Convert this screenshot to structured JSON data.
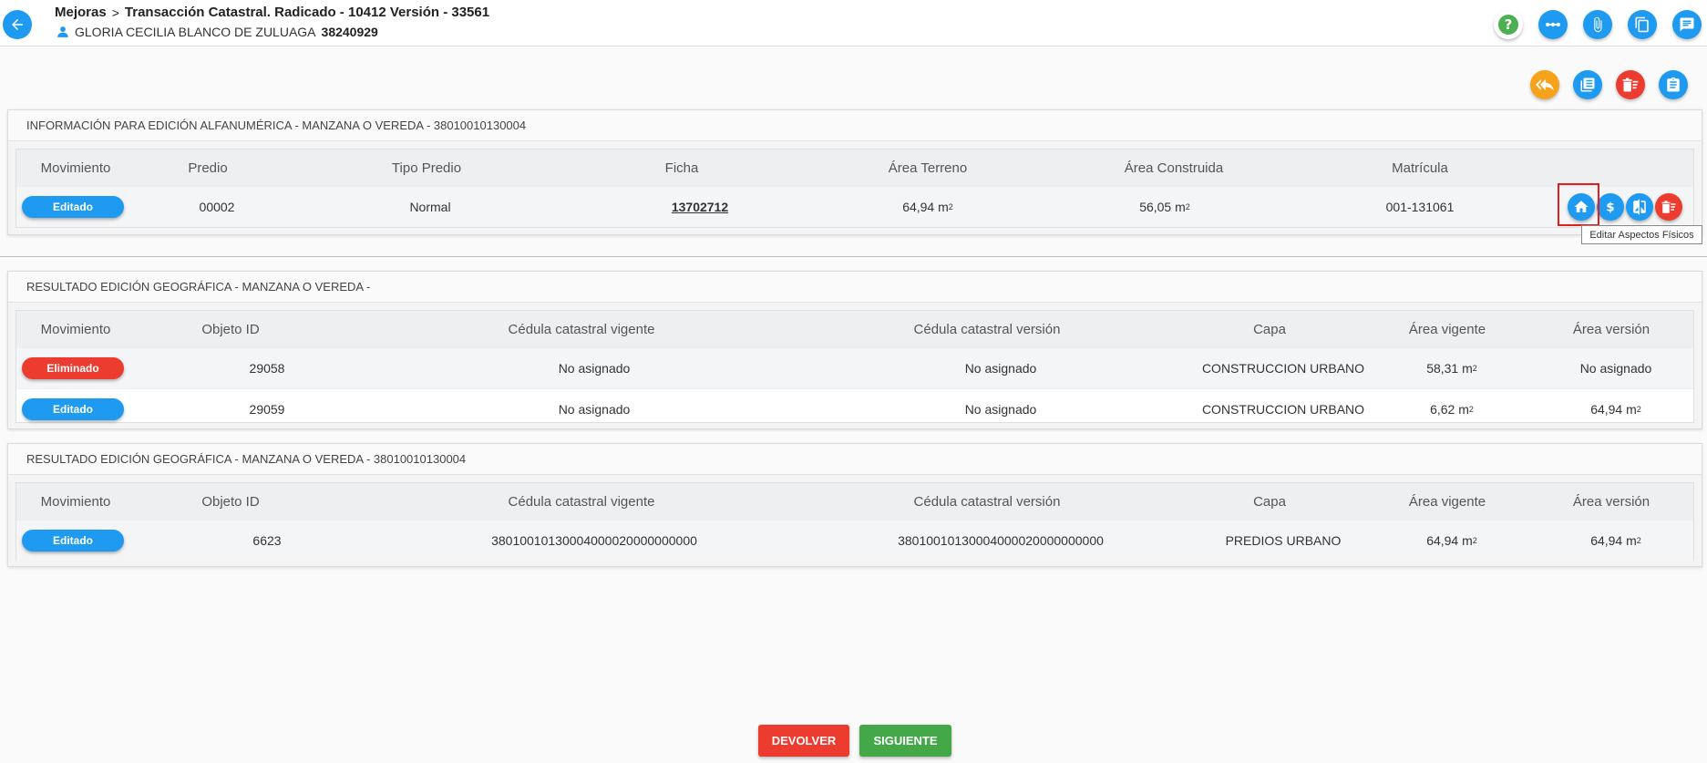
{
  "header": {
    "crumb_module": "Mejoras",
    "crumb_sep": ">",
    "crumb_transaction": "Transacción Catastral. Radicado - 10412 Versión - 33561",
    "owner_name": "GLORIA CECILIA BLANCO DE ZULUAGA",
    "owner_doc": "38240929"
  },
  "panel1": {
    "title": "INFORMACIÓN PARA EDICIÓN ALFANUMÉRICA - MANZANA O VEREDA - 38010010130004",
    "columns": [
      "Movimiento",
      "Predio",
      "Tipo Predio",
      "Ficha",
      "Área Terreno",
      "Área Construida",
      "Matrícula"
    ],
    "row": {
      "movimiento": "Editado",
      "predio": "00002",
      "tipo_predio": "Normal",
      "ficha": "13702712",
      "area_terreno": "64,94 m",
      "area_construida": "56,05 m",
      "matricula": "001-131061"
    },
    "tooltip": "Editar Aspectos Físicos"
  },
  "panel2": {
    "title": "RESULTADO EDICIÓN GEOGRÁFICA - MANZANA O VEREDA -",
    "columns": [
      "Movimiento",
      "Objeto ID",
      "Cédula catastral vigente",
      "Cédula catastral versión",
      "Capa",
      "Área vigente",
      "Área versión"
    ],
    "rows": [
      {
        "movimiento": "Eliminado",
        "objeto_id": "29058",
        "cedula_vigente": "No asignado",
        "cedula_version": "No asignado",
        "capa": "CONSTRUCCION URBANO",
        "area_vigente": "58,31 m",
        "area_version": "No asignado"
      },
      {
        "movimiento": "Editado",
        "objeto_id": "29059",
        "cedula_vigente": "No asignado",
        "cedula_version": "No asignado",
        "capa": "CONSTRUCCION URBANO",
        "area_vigente": "6,62 m",
        "area_version": "64,94 m"
      }
    ]
  },
  "panel3": {
    "title": "RESULTADO EDICIÓN GEOGRÁFICA - MANZANA O VEREDA - 38010010130004",
    "columns": [
      "Movimiento",
      "Objeto ID",
      "Cédula catastral vigente",
      "Cédula catastral versión",
      "Capa",
      "Área vigente",
      "Área versión"
    ],
    "row": {
      "movimiento": "Editado",
      "objeto_id": "6623",
      "cedula_vigente": "38010010130004000020000000000",
      "cedula_version": "38010010130004000020000000000",
      "capa": "PREDIOS URBANO",
      "area_vigente": "64,94 m",
      "area_version": "64,94 m"
    }
  },
  "units": {
    "sup": "2"
  },
  "footer": {
    "devolver": "DEVOLVER",
    "siguiente": "SIGUIENTE"
  },
  "colors": {
    "primary": "#1e9bf0",
    "danger": "#ec3b2f",
    "success": "#44a849",
    "warning": "#f7a21b"
  }
}
